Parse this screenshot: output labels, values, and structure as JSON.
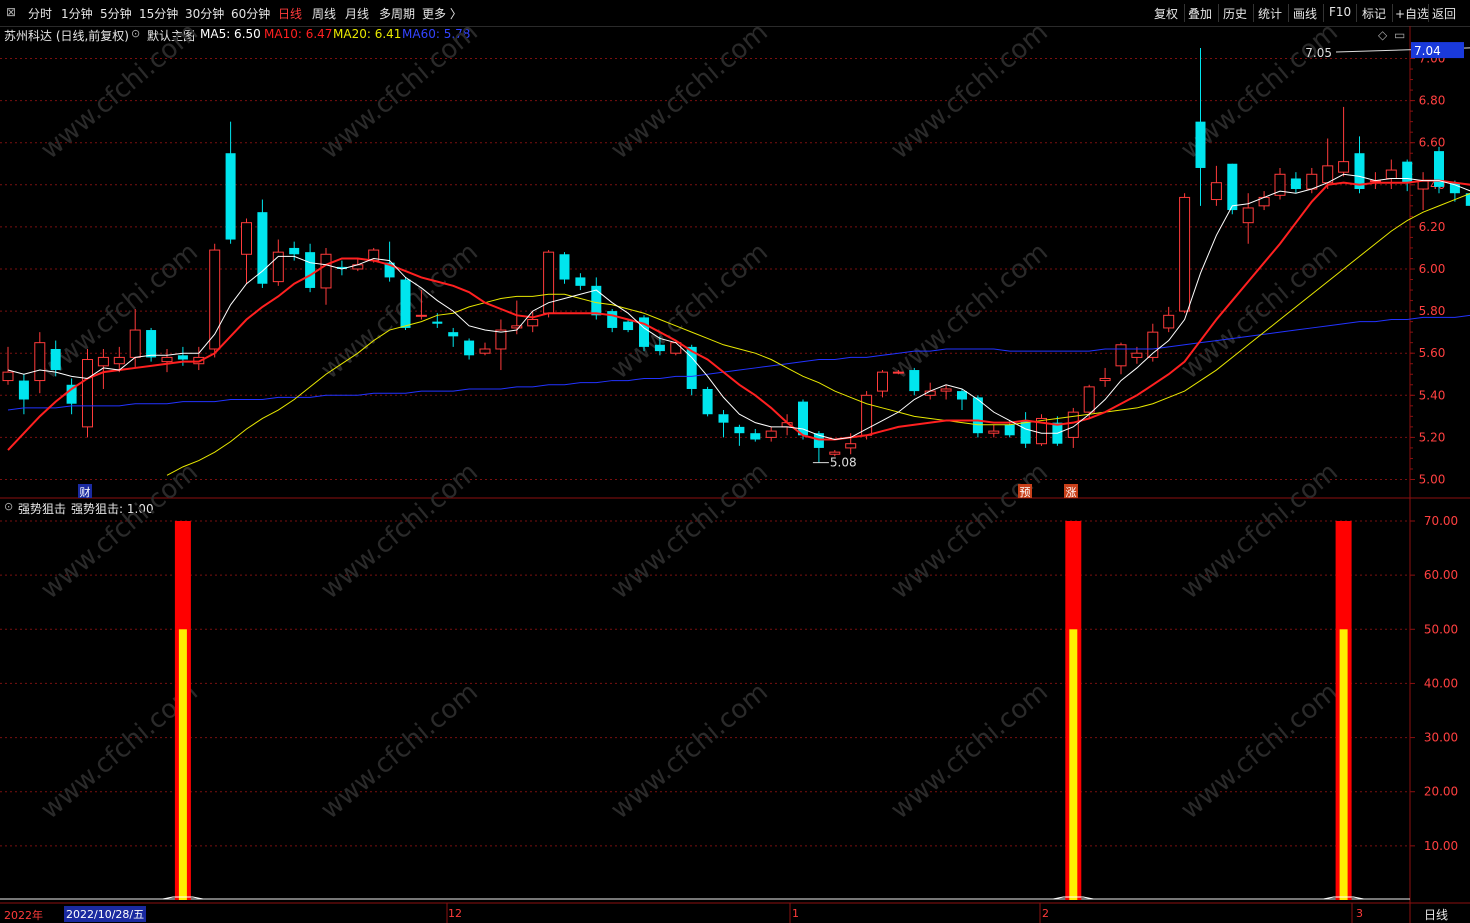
{
  "toolbar": {
    "periods": [
      "分时",
      "1分钟",
      "5分钟",
      "15分钟",
      "30分钟",
      "60分钟",
      "日线",
      "周线",
      "月线",
      "多周期",
      "更多 〉"
    ],
    "active_period": "日线",
    "right_buttons": [
      "复权",
      "叠加",
      "历史",
      "统计",
      "画线",
      "F10",
      "标记",
      "+自选",
      "返回"
    ]
  },
  "main_chart": {
    "stock_title": "苏州科达 (日线,前复权)",
    "template": "默认主图",
    "ma5_label": "MA5: 6.50",
    "ma10_label": "MA10: 6.47",
    "ma20_label": "MA20: 6.41",
    "ma60_label": "MA60: 5.78",
    "current_price": "7.04",
    "high_annotation": "7.05",
    "low_annotation": "5.08",
    "markers": [
      "财",
      "预",
      "涨"
    ],
    "price_ticks": [
      "7.00",
      "6.80",
      "6.60",
      "6.40",
      "6.20",
      "6.00",
      "5.80",
      "5.60",
      "5.40",
      "5.20",
      "5.00"
    ]
  },
  "sub_chart": {
    "indicator_name": "强势狙击",
    "indicator_value": "强势狙击: 1.00",
    "ticks": [
      "70.00",
      "60.00",
      "50.00",
      "40.00",
      "30.00",
      "20.00",
      "10.00"
    ]
  },
  "date_axis": {
    "year": "2022年",
    "cursor_date": "2022/10/28/五",
    "months": [
      "12",
      "1",
      "2",
      "3"
    ],
    "period_label": "日线"
  },
  "colors": {
    "up": "#ff3b3b",
    "down": "#00e5ee",
    "ma5": "#ffffff",
    "ma10": "#ff2020",
    "ma20": "#e8e800",
    "ma60": "#2233ff",
    "grid": "#7a1010"
  },
  "chart_data": {
    "type": "candlestick",
    "y_range": [
      4.95,
      7.1
    ],
    "candles": [
      {
        "o": 5.47,
        "c": 5.51,
        "h": 5.63,
        "l": 5.45
      },
      {
        "o": 5.47,
        "c": 5.38,
        "h": 5.5,
        "l": 5.31
      },
      {
        "o": 5.47,
        "c": 5.65,
        "h": 5.7,
        "l": 5.41
      },
      {
        "o": 5.62,
        "c": 5.52,
        "h": 5.66,
        "l": 5.49
      },
      {
        "o": 5.45,
        "c": 5.36,
        "h": 5.48,
        "l": 5.31
      },
      {
        "o": 5.25,
        "c": 5.57,
        "h": 5.62,
        "l": 5.2
      },
      {
        "o": 5.54,
        "c": 5.58,
        "h": 5.62,
        "l": 5.43
      },
      {
        "o": 5.55,
        "c": 5.58,
        "h": 5.63,
        "l": 5.51
      },
      {
        "o": 5.58,
        "c": 5.71,
        "h": 5.81,
        "l": 5.53
      },
      {
        "o": 5.71,
        "c": 5.58,
        "h": 5.72,
        "l": 5.56
      },
      {
        "o": 5.56,
        "c": 5.58,
        "h": 5.62,
        "l": 5.51
      },
      {
        "o": 5.59,
        "c": 5.57,
        "h": 5.63,
        "l": 5.54
      },
      {
        "o": 5.55,
        "c": 5.58,
        "h": 5.63,
        "l": 5.52
      },
      {
        "o": 5.62,
        "c": 6.09,
        "h": 6.12,
        "l": 5.58
      },
      {
        "o": 6.55,
        "c": 6.14,
        "h": 6.7,
        "l": 6.12
      },
      {
        "o": 6.07,
        "c": 6.22,
        "h": 6.24,
        "l": 5.93
      },
      {
        "o": 6.27,
        "c": 5.93,
        "h": 6.33,
        "l": 5.91
      },
      {
        "o": 5.94,
        "c": 6.08,
        "h": 6.14,
        "l": 5.92
      },
      {
        "o": 6.1,
        "c": 6.07,
        "h": 6.13,
        "l": 6.04
      },
      {
        "o": 6.08,
        "c": 5.91,
        "h": 6.12,
        "l": 5.89
      },
      {
        "o": 5.91,
        "c": 6.07,
        "h": 6.1,
        "l": 5.83
      },
      {
        "o": 6.01,
        "c": 6.0,
        "h": 6.04,
        "l": 5.97
      },
      {
        "o": 6.0,
        "c": 6.02,
        "h": 6.05,
        "l": 5.99
      },
      {
        "o": 6.04,
        "c": 6.09,
        "h": 6.1,
        "l": 6.03
      },
      {
        "o": 6.03,
        "c": 5.96,
        "h": 6.13,
        "l": 5.94
      },
      {
        "o": 5.95,
        "c": 5.72,
        "h": 5.96,
        "l": 5.71
      },
      {
        "o": 5.78,
        "c": 5.78,
        "h": 5.9,
        "l": 5.76
      },
      {
        "o": 5.75,
        "c": 5.74,
        "h": 5.79,
        "l": 5.72
      },
      {
        "o": 5.7,
        "c": 5.68,
        "h": 5.72,
        "l": 5.63
      },
      {
        "o": 5.66,
        "c": 5.59,
        "h": 5.67,
        "l": 5.57
      },
      {
        "o": 5.6,
        "c": 5.62,
        "h": 5.65,
        "l": 5.59
      },
      {
        "o": 5.62,
        "c": 5.71,
        "h": 5.76,
        "l": 5.52
      },
      {
        "o": 5.72,
        "c": 5.73,
        "h": 5.85,
        "l": 5.69
      },
      {
        "o": 5.73,
        "c": 5.76,
        "h": 5.8,
        "l": 5.7
      },
      {
        "o": 5.79,
        "c": 6.08,
        "h": 6.09,
        "l": 5.77
      },
      {
        "o": 6.07,
        "c": 5.95,
        "h": 6.08,
        "l": 5.93
      },
      {
        "o": 5.96,
        "c": 5.92,
        "h": 5.98,
        "l": 5.9
      },
      {
        "o": 5.92,
        "c": 5.78,
        "h": 5.96,
        "l": 5.76
      },
      {
        "o": 5.8,
        "c": 5.72,
        "h": 5.81,
        "l": 5.7
      },
      {
        "o": 5.75,
        "c": 5.71,
        "h": 5.76,
        "l": 5.7
      },
      {
        "o": 5.77,
        "c": 5.63,
        "h": 5.78,
        "l": 5.61
      },
      {
        "o": 5.64,
        "c": 5.61,
        "h": 5.68,
        "l": 5.59
      },
      {
        "o": 5.6,
        "c": 5.65,
        "h": 5.66,
        "l": 5.59
      },
      {
        "o": 5.63,
        "c": 5.43,
        "h": 5.64,
        "l": 5.4
      },
      {
        "o": 5.43,
        "c": 5.31,
        "h": 5.44,
        "l": 5.3
      },
      {
        "o": 5.31,
        "c": 5.27,
        "h": 5.33,
        "l": 5.2
      },
      {
        "o": 5.25,
        "c": 5.22,
        "h": 5.26,
        "l": 5.16
      },
      {
        "o": 5.22,
        "c": 5.19,
        "h": 5.24,
        "l": 5.18
      },
      {
        "o": 5.2,
        "c": 5.23,
        "h": 5.25,
        "l": 5.18
      },
      {
        "o": 5.25,
        "c": 5.27,
        "h": 5.31,
        "l": 5.21
      },
      {
        "o": 5.37,
        "c": 5.21,
        "h": 5.38,
        "l": 5.19
      },
      {
        "o": 5.22,
        "c": 5.15,
        "h": 5.23,
        "l": 5.08
      },
      {
        "o": 5.12,
        "c": 5.13,
        "h": 5.14,
        "l": 5.11
      },
      {
        "o": 5.15,
        "c": 5.17,
        "h": 5.22,
        "l": 5.12
      },
      {
        "o": 5.21,
        "c": 5.4,
        "h": 5.42,
        "l": 5.19
      },
      {
        "o": 5.42,
        "c": 5.51,
        "h": 5.52,
        "l": 5.39
      },
      {
        "o": 5.51,
        "c": 5.51,
        "h": 5.52,
        "l": 5.5
      },
      {
        "o": 5.52,
        "c": 5.42,
        "h": 5.53,
        "l": 5.4
      },
      {
        "o": 5.4,
        "c": 5.42,
        "h": 5.46,
        "l": 5.38
      },
      {
        "o": 5.42,
        "c": 5.43,
        "h": 5.45,
        "l": 5.38
      },
      {
        "o": 5.42,
        "c": 5.38,
        "h": 5.43,
        "l": 5.33
      },
      {
        "o": 5.39,
        "c": 5.22,
        "h": 5.4,
        "l": 5.2
      },
      {
        "o": 5.22,
        "c": 5.23,
        "h": 5.26,
        "l": 5.2
      },
      {
        "o": 5.26,
        "c": 5.21,
        "h": 5.28,
        "l": 5.2
      },
      {
        "o": 5.28,
        "c": 5.17,
        "h": 5.32,
        "l": 5.15
      },
      {
        "o": 5.17,
        "c": 5.29,
        "h": 5.31,
        "l": 5.16
      },
      {
        "o": 5.27,
        "c": 5.17,
        "h": 5.3,
        "l": 5.16
      },
      {
        "o": 5.2,
        "c": 5.32,
        "h": 5.34,
        "l": 5.15
      },
      {
        "o": 5.32,
        "c": 5.44,
        "h": 5.45,
        "l": 5.29
      },
      {
        "o": 5.47,
        "c": 5.48,
        "h": 5.53,
        "l": 5.44
      },
      {
        "o": 5.54,
        "c": 5.64,
        "h": 5.65,
        "l": 5.5
      },
      {
        "o": 5.58,
        "c": 5.6,
        "h": 5.63,
        "l": 5.55
      },
      {
        "o": 5.58,
        "c": 5.7,
        "h": 5.74,
        "l": 5.56
      },
      {
        "o": 5.72,
        "c": 5.78,
        "h": 5.82,
        "l": 5.7
      },
      {
        "o": 5.8,
        "c": 6.34,
        "h": 6.36,
        "l": 5.79
      },
      {
        "o": 6.7,
        "c": 6.48,
        "h": 7.05,
        "l": 6.3
      },
      {
        "o": 6.33,
        "c": 6.41,
        "h": 6.49,
        "l": 6.3
      },
      {
        "o": 6.5,
        "c": 6.28,
        "h": 6.5,
        "l": 6.26
      },
      {
        "o": 6.22,
        "c": 6.29,
        "h": 6.36,
        "l": 6.12
      },
      {
        "o": 6.3,
        "c": 6.34,
        "h": 6.37,
        "l": 6.28
      },
      {
        "o": 6.35,
        "c": 6.45,
        "h": 6.48,
        "l": 6.33
      },
      {
        "o": 6.43,
        "c": 6.38,
        "h": 6.46,
        "l": 6.36
      },
      {
        "o": 6.38,
        "c": 6.45,
        "h": 6.48,
        "l": 6.36
      },
      {
        "o": 6.41,
        "c": 6.49,
        "h": 6.62,
        "l": 6.38
      },
      {
        "o": 6.46,
        "c": 6.51,
        "h": 6.77,
        "l": 6.44
      },
      {
        "o": 6.55,
        "c": 6.38,
        "h": 6.63,
        "l": 6.36
      },
      {
        "o": 6.42,
        "c": 6.42,
        "h": 6.46,
        "l": 6.38
      },
      {
        "o": 6.43,
        "c": 6.47,
        "h": 6.52,
        "l": 6.38
      },
      {
        "o": 6.51,
        "c": 6.41,
        "h": 6.52,
        "l": 6.37
      },
      {
        "o": 6.38,
        "c": 6.42,
        "h": 6.46,
        "l": 6.28
      },
      {
        "o": 6.56,
        "c": 6.39,
        "h": 6.58,
        "l": 6.36
      },
      {
        "o": 6.41,
        "c": 6.36,
        "h": 6.42,
        "l": 6.32
      },
      {
        "o": 6.36,
        "c": 6.3,
        "h": 6.38,
        "l": 6.28
      },
      {
        "o": 6.38,
        "c": 6.42,
        "h": 6.48,
        "l": 6.35
      },
      {
        "o": 6.4,
        "c": 7.04,
        "h": 7.05,
        "l": 6.4
      }
    ],
    "ma5": [
      5.52,
      5.5,
      5.52,
      5.51,
      5.49,
      5.48,
      5.53,
      5.52,
      5.58,
      5.59,
      5.59,
      5.6,
      5.6,
      5.69,
      5.83,
      5.93,
      5.99,
      6.06,
      6.06,
      6.03,
      6.02,
      6.0,
      6.02,
      6.05,
      6.04,
      5.96,
      5.91,
      5.85,
      5.8,
      5.73,
      5.71,
      5.7,
      5.71,
      5.8,
      5.84,
      5.86,
      5.88,
      5.9,
      5.84,
      5.79,
      5.72,
      5.67,
      5.65,
      5.58,
      5.49,
      5.39,
      5.31,
      5.27,
      5.25,
      5.25,
      5.24,
      5.21,
      5.19,
      5.2,
      5.24,
      5.28,
      5.32,
      5.38,
      5.42,
      5.45,
      5.43,
      5.38,
      5.32,
      5.28,
      5.24,
      5.22,
      5.22,
      5.25,
      5.31,
      5.38,
      5.47,
      5.53,
      5.6,
      5.66,
      5.76,
      5.98,
      6.16,
      6.3,
      6.31,
      6.34,
      6.37,
      6.36,
      6.38,
      6.41,
      6.45,
      6.44,
      6.42,
      6.43,
      6.43,
      6.42,
      6.42,
      6.4,
      6.37,
      6.38,
      6.48
    ],
    "ma10": [
      5.14,
      5.22,
      5.3,
      5.37,
      5.43,
      5.48,
      5.51,
      5.52,
      5.53,
      5.54,
      5.55,
      5.56,
      5.56,
      5.6,
      5.68,
      5.76,
      5.82,
      5.87,
      5.93,
      5.97,
      6.02,
      6.05,
      6.05,
      6.04,
      6.02,
      5.99,
      5.96,
      5.94,
      5.92,
      5.89,
      5.84,
      5.81,
      5.78,
      5.77,
      5.79,
      5.79,
      5.79,
      5.79,
      5.78,
      5.76,
      5.74,
      5.7,
      5.66,
      5.61,
      5.57,
      5.51,
      5.45,
      5.4,
      5.34,
      5.27,
      5.21,
      5.19,
      5.19,
      5.2,
      5.21,
      5.23,
      5.25,
      5.26,
      5.27,
      5.28,
      5.28,
      5.28,
      5.27,
      5.27,
      5.28,
      5.27,
      5.26,
      5.27,
      5.29,
      5.32,
      5.36,
      5.4,
      5.45,
      5.5,
      5.56,
      5.66,
      5.76,
      5.85,
      5.94,
      6.03,
      6.12,
      6.22,
      6.32,
      6.4,
      6.41,
      6.4,
      6.41,
      6.41,
      6.41,
      6.42,
      6.42,
      6.41,
      6.4,
      6.4,
      6.44
    ],
    "ma20": [
      5.02,
      5.06,
      5.09,
      5.13,
      5.18,
      5.24,
      5.29,
      5.33,
      5.38,
      5.44,
      5.5,
      5.55,
      5.6,
      5.66,
      5.71,
      5.73,
      5.75,
      5.78,
      5.79,
      5.82,
      5.84,
      5.86,
      5.87,
      5.87,
      5.88,
      5.88,
      5.86,
      5.84,
      5.83,
      5.81,
      5.79,
      5.76,
      5.73,
      5.7,
      5.67,
      5.64,
      5.62,
      5.6,
      5.57,
      5.53,
      5.49,
      5.46,
      5.42,
      5.39,
      5.36,
      5.34,
      5.32,
      5.3,
      5.29,
      5.28,
      5.27,
      5.26,
      5.26,
      5.26,
      5.27,
      5.28,
      5.29,
      5.3,
      5.31,
      5.32,
      5.33,
      5.34,
      5.36,
      5.39,
      5.42,
      5.47,
      5.52,
      5.58,
      5.64,
      5.7,
      5.76,
      5.82,
      5.88,
      5.94,
      6.0,
      6.06,
      6.12,
      6.18,
      6.23,
      6.27,
      6.3,
      6.33,
      6.36,
      6.39,
      6.41
    ],
    "ma60": [
      5.33,
      5.34,
      5.34,
      5.34,
      5.35,
      5.35,
      5.35,
      5.35,
      5.36,
      5.36,
      5.36,
      5.37,
      5.37,
      5.37,
      5.38,
      5.38,
      5.38,
      5.39,
      5.39,
      5.39,
      5.4,
      5.4,
      5.4,
      5.41,
      5.41,
      5.41,
      5.42,
      5.42,
      5.42,
      5.43,
      5.43,
      5.43,
      5.44,
      5.44,
      5.45,
      5.45,
      5.46,
      5.46,
      5.47,
      5.47,
      5.48,
      5.48,
      5.49,
      5.49,
      5.5,
      5.51,
      5.52,
      5.53,
      5.54,
      5.55,
      5.56,
      5.57,
      5.57,
      5.58,
      5.58,
      5.59,
      5.6,
      5.61,
      5.61,
      5.62,
      5.62,
      5.62,
      5.62,
      5.61,
      5.61,
      5.61,
      5.61,
      5.61,
      5.61,
      5.62,
      5.62,
      5.62,
      5.62,
      5.63,
      5.64,
      5.65,
      5.66,
      5.67,
      5.68,
      5.69,
      5.7,
      5.71,
      5.72,
      5.73,
      5.74,
      5.75,
      5.75,
      5.76,
      5.76,
      5.77,
      5.77,
      5.77,
      5.78,
      5.78,
      5.78
    ],
    "indicator": {
      "y_range": [
        0,
        70
      ],
      "signal_bars": [
        {
          "index": 11,
          "red_top": 70,
          "yellow_top": 50
        },
        {
          "index": 67,
          "red_top": 70,
          "yellow_top": 50
        },
        {
          "index": 84,
          "red_top": 70,
          "yellow_top": 50
        }
      ]
    }
  }
}
